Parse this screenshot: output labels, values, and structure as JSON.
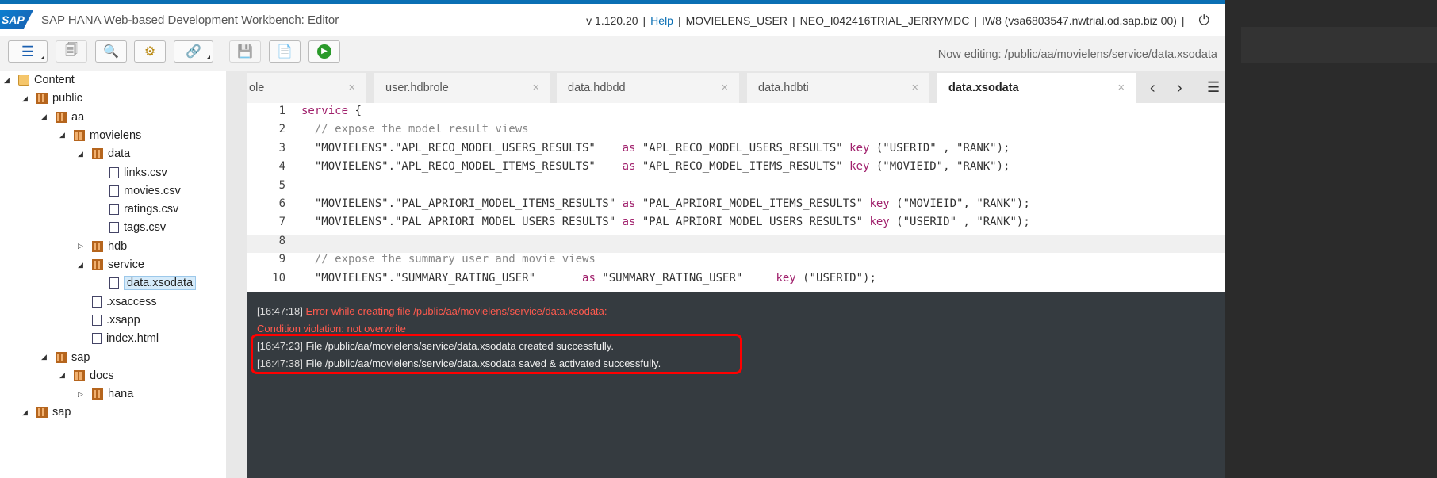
{
  "header": {
    "logo": "SAP",
    "title": "SAP HANA Web-based Development Workbench: Editor",
    "version": "v 1.120.20",
    "help": "Help",
    "user": "MOVIELENS_USER",
    "account": "NEO_I042416TRIAL_JERRYMDC",
    "system": "IW8 (vsa6803547.nwtrial.od.sap.biz 00)"
  },
  "toolbar": {
    "now_editing": "Now editing: /public/aa/movielens/service/data.xsodata"
  },
  "tree": [
    {
      "label": "Content",
      "type": "folder",
      "level": 0,
      "exp": "open"
    },
    {
      "label": "public",
      "type": "pkg",
      "level": 1,
      "exp": "open"
    },
    {
      "label": "aa",
      "type": "pkg",
      "level": 2,
      "exp": "open"
    },
    {
      "label": "movielens",
      "type": "pkg",
      "level": 3,
      "exp": "open"
    },
    {
      "label": "data",
      "type": "pkg",
      "level": 4,
      "exp": "open"
    },
    {
      "label": "links.csv",
      "type": "file",
      "level": 5
    },
    {
      "label": "movies.csv",
      "type": "file",
      "level": 5
    },
    {
      "label": "ratings.csv",
      "type": "file",
      "level": 5
    },
    {
      "label": "tags.csv",
      "type": "file",
      "level": 5
    },
    {
      "label": "hdb",
      "type": "pkg",
      "level": 4,
      "exp": "closed"
    },
    {
      "label": "service",
      "type": "pkg",
      "level": 4,
      "exp": "open"
    },
    {
      "label": "data.xsodata",
      "type": "file",
      "level": 5,
      "selected": true
    },
    {
      "label": ".xsaccess",
      "type": "file",
      "level": 4
    },
    {
      "label": ".xsapp",
      "type": "file",
      "level": 4
    },
    {
      "label": "index.html",
      "type": "file",
      "level": 4
    },
    {
      "label": "sap",
      "type": "pkg",
      "level": 2,
      "exp": "open"
    },
    {
      "label": "docs",
      "type": "pkg",
      "level": 3,
      "exp": "open"
    },
    {
      "label": "hana",
      "type": "pkg",
      "level": 4,
      "exp": "closed"
    },
    {
      "label": "sap",
      "type": "pkg",
      "level": 1,
      "exp": "open"
    }
  ],
  "tabs": [
    {
      "label": "ole"
    },
    {
      "label": "user.hdbrole"
    },
    {
      "label": "data.hdbdd"
    },
    {
      "label": "data.hdbti"
    },
    {
      "label": "data.xsodata",
      "active": true
    }
  ],
  "tab_close": "×",
  "code": [
    [
      [
        "kw",
        "service"
      ],
      [
        "pl",
        " {"
      ]
    ],
    [
      [
        "cm",
        "  // expose the model result views"
      ]
    ],
    [
      [
        "str",
        "  \"MOVIELENS\".\"APL_RECO_MODEL_USERS_RESULTS\"    "
      ],
      [
        "kw",
        "as"
      ],
      [
        "str",
        " \"APL_RECO_MODEL_USERS_RESULTS\" "
      ],
      [
        "kw",
        "key"
      ],
      [
        "str",
        " (\"USERID\" , \"RANK\");"
      ]
    ],
    [
      [
        "str",
        "  \"MOVIELENS\".\"APL_RECO_MODEL_ITEMS_RESULTS\"    "
      ],
      [
        "kw",
        "as"
      ],
      [
        "str",
        " \"APL_RECO_MODEL_ITEMS_RESULTS\" "
      ],
      [
        "kw",
        "key"
      ],
      [
        "str",
        " (\"MOVIEID\", \"RANK\");"
      ]
    ],
    [],
    [
      [
        "str",
        "  \"MOVIELENS\".\"PAL_APRIORI_MODEL_ITEMS_RESULTS\" "
      ],
      [
        "kw",
        "as"
      ],
      [
        "str",
        " \"PAL_APRIORI_MODEL_ITEMS_RESULTS\" "
      ],
      [
        "kw",
        "key"
      ],
      [
        "str",
        " (\"MOVIEID\", \"RANK\");"
      ]
    ],
    [
      [
        "str",
        "  \"MOVIELENS\".\"PAL_APRIORI_MODEL_USERS_RESULTS\" "
      ],
      [
        "kw",
        "as"
      ],
      [
        "str",
        " \"PAL_APRIORI_MODEL_USERS_RESULTS\" "
      ],
      [
        "kw",
        "key"
      ],
      [
        "str",
        " (\"USERID\" , \"RANK\");"
      ]
    ],
    [],
    [
      [
        "cm",
        "  // expose the summary user and movie views"
      ]
    ],
    [
      [
        "str",
        "  \"MOVIELENS\".\"SUMMARY_RATING_USER\"       "
      ],
      [
        "kw",
        "as"
      ],
      [
        "str",
        " \"SUMMARY_RATING_USER\"     "
      ],
      [
        "kw",
        "key"
      ],
      [
        "str",
        " (\"USERID\");"
      ]
    ]
  ],
  "console": [
    {
      "ts": "[16:47:18]",
      "msg": " Error while creating file /public/aa/movielens/service/data.xsodata:",
      "kind": "err"
    },
    {
      "ts": "",
      "msg": "Condition violation: not overwrite",
      "kind": "err"
    },
    {
      "ts": "[16:47:23]",
      "msg": " File /public/aa/movielens/service/data.xsodata created successfully.",
      "kind": "ok"
    },
    {
      "ts": "[16:47:38]",
      "msg": " File /public/aa/movielens/service/data.xsodata saved & activated successfully.",
      "kind": "ok"
    }
  ]
}
